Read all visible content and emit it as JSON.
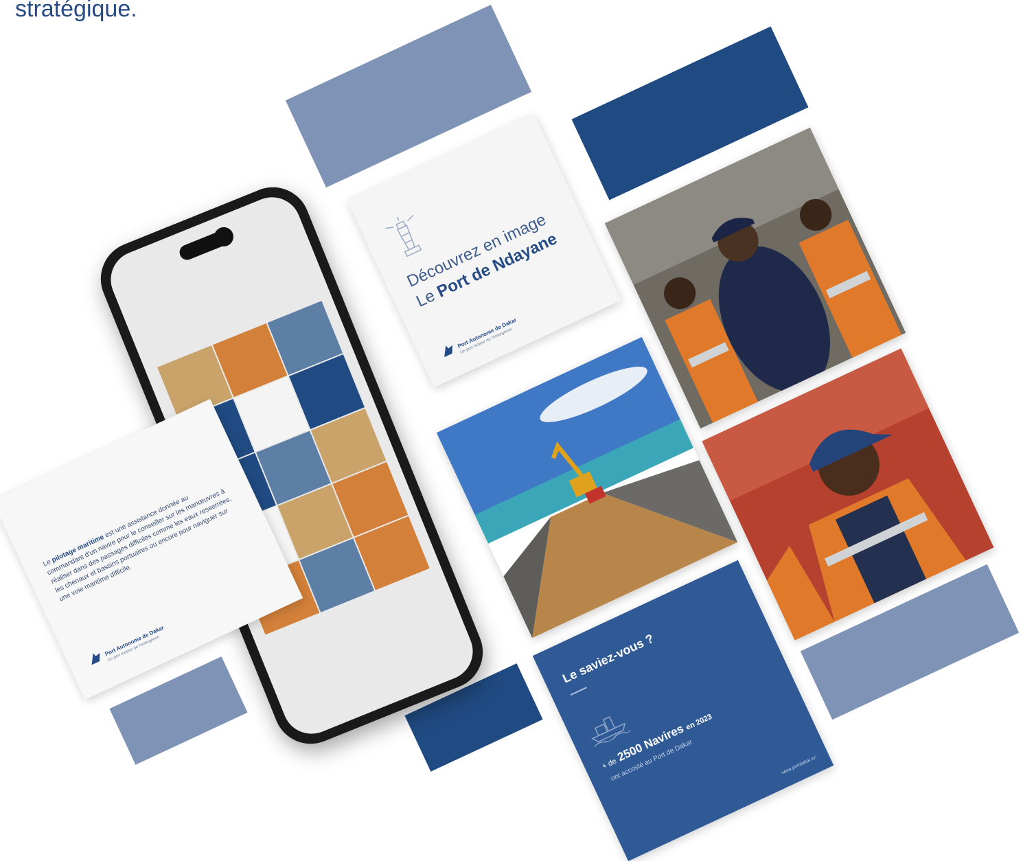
{
  "heading": "stratégique.",
  "lighthouse_card": {
    "line1": "Découvrez en image",
    "line2_prefix": "Le ",
    "line2_bold": "Port de Ndayane",
    "logo_name": "Port Autonome de Dakar",
    "logo_tagline": "Un port moteur de l'émergence"
  },
  "pilotage_card": {
    "bold": "pilotage maritime",
    "line1": "Le",
    "rest": "est une assistance donnée au commandant d'un navire pour le conseiller sur les manœuvres à réaliser dans des passages difficiles comme les eaux resserrées, les chenaux et bassins portuaires ou encore pour naviguer sur une voie maritime difficile.",
    "logo_name": "Port Autonome de Dakar",
    "logo_tagline": "Un port moteur de l'émergence"
  },
  "saviez_card": {
    "title": "Le saviez-vous ?",
    "prefix": "+ de",
    "number": "2500 Navires",
    "suffix": "en 2023",
    "subline": "ont accosté au Port de Dakar",
    "website": "www.portdakar.sn"
  },
  "colors": {
    "light_blue": "#7f93b6",
    "dark_blue": "#204b82",
    "heading": "#254a85"
  }
}
